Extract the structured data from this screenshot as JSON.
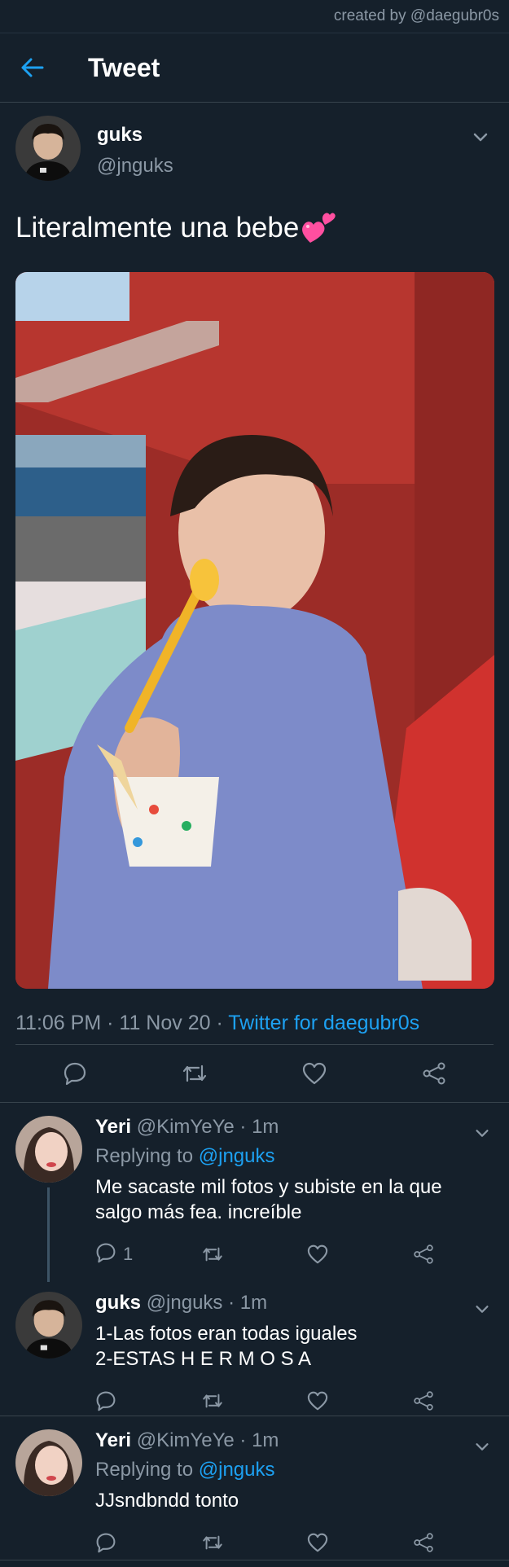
{
  "credit": "created by @daegubr0s",
  "header": {
    "title": "Tweet"
  },
  "tweet": {
    "author_name": "guks",
    "author_handle": "@jnguks",
    "text": "Literalmente una bebe",
    "time": "11:06 PM",
    "date": "11 Nov 20",
    "source": "Twitter for daegubr0s"
  },
  "replies": [
    {
      "name": "Yeri",
      "handle": "@KimYeYe",
      "time": "1m",
      "replying_label": "Replying to",
      "replying_to": "@jnguks",
      "text": "Me sacaste mil fotos y subiste en la que salgo más fea. increíble",
      "reply_count": "1"
    },
    {
      "name": "guks",
      "handle": "@jnguks",
      "time": "1m",
      "text": "1-Las fotos eran todas iguales\n2-ESTAS H E R M O S A"
    },
    {
      "name": "Yeri",
      "handle": "@KimYeYe",
      "time": "1m",
      "replying_label": "Replying to",
      "replying_to": "@jnguks",
      "text": "JJsndbndd tonto"
    }
  ],
  "colors": {
    "background": "#15202b",
    "accent": "#1da1f2",
    "muted": "#8b98a5",
    "emoji": "#ff4fa0"
  },
  "icons": [
    "back-arrow-icon",
    "chevron-down-icon",
    "reply-icon",
    "retweet-icon",
    "like-icon",
    "share-icon",
    "heart-emoji-icon"
  ]
}
